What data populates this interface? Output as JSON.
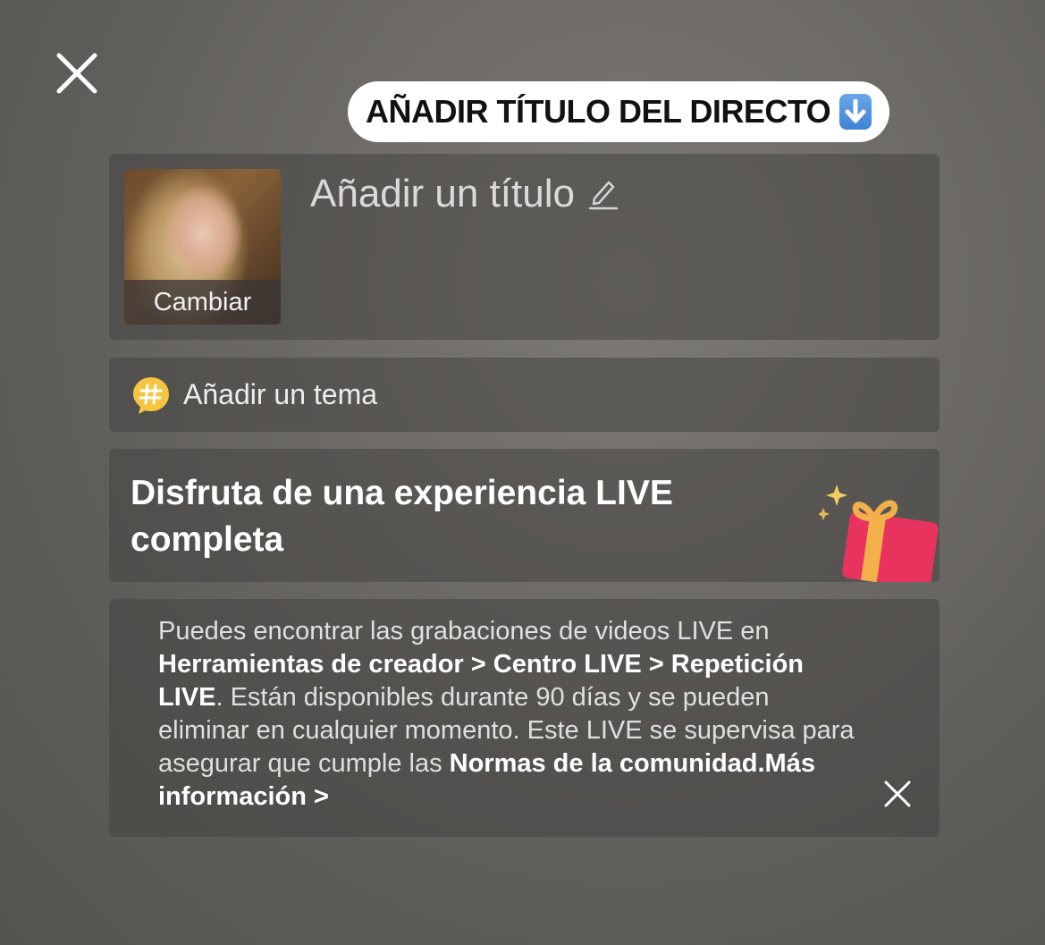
{
  "banner": {
    "text": "AÑADIR TÍTULO DEL DIRECTO"
  },
  "title_card": {
    "change_label": "Cambiar",
    "title_placeholder": "Añadir un título"
  },
  "topic_card": {
    "label": "Añadir un tema"
  },
  "promo_card": {
    "text": "Disfruta de una experiencia LIVE completa"
  },
  "info_card": {
    "p1": "Puedes encontrar las grabaciones de videos LIVE en ",
    "link1": "Herramientas de creador > Centro LIVE > Repetición LIVE",
    "p2": ". Están disponibles durante 90 días y se pueden eliminar en cualquier momento. Este LIVE se supervisa para asegurar que cumple las ",
    "link2": "Normas de la comunidad",
    "link3": ".Más información >"
  },
  "colors": {
    "topic_icon": "#f5c542",
    "arrow_emoji": "#3f83d4",
    "gift": "#e8335f"
  },
  "icons": [
    "close-icon",
    "down-arrow-icon",
    "pencil-icon",
    "hashtag-icon",
    "gift-icon",
    "sparkle-icon",
    "close-icon"
  ]
}
